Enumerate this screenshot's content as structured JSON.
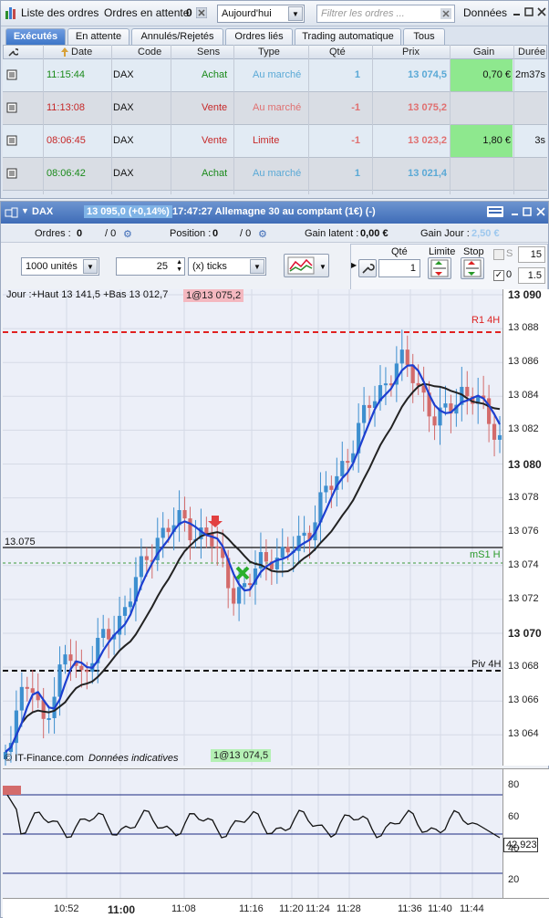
{
  "toolbar": {
    "list_label": "Liste des ordres",
    "pending_label": "Ordres en attente",
    "pending_count": "0",
    "period": "Aujourd'hui",
    "filter_placeholder": "Filtrer les ordres ...",
    "data_label": "Données"
  },
  "tabs": [
    "Exécutés",
    "En attente",
    "Annulés/Rejetés",
    "Ordres liés",
    "Trading automatique",
    "Tous"
  ],
  "grid": {
    "headers": [
      "Date",
      "Code",
      "Sens",
      "Type",
      "Qté",
      "Prix",
      "Gain",
      "Durée"
    ],
    "rows": [
      {
        "time": "11:15:44",
        "code": "DAX",
        "side": "Achat",
        "type": "Au marché",
        "qty": "1",
        "price": "13 074,5",
        "gain": "0,70 €",
        "duration": "2m37s"
      },
      {
        "time": "11:13:08",
        "code": "DAX",
        "side": "Vente",
        "type": "Au marché",
        "qty": "-1",
        "price": "13 075,2",
        "gain": "",
        "duration": ""
      },
      {
        "time": "08:06:45",
        "code": "DAX",
        "side": "Vente",
        "type": "Limite",
        "qty": "-1",
        "price": "13 023,2",
        "gain": "1,80 €",
        "duration": "3s"
      },
      {
        "time": "08:06:42",
        "code": "DAX",
        "side": "Achat",
        "type": "Au marché",
        "qty": "1",
        "price": "13 021,4",
        "gain": "",
        "duration": ""
      }
    ]
  },
  "chart": {
    "symbol": "DAX",
    "quote": "13 095,0 (+0,14%)",
    "title": "17:47:27 Allemagne 30 au comptant (1€) (-)",
    "orders_label": "Ordres :",
    "orders_val": "0",
    "orders_val2": "/ 0",
    "position_label": "Position :",
    "position_val": "0",
    "position_val2": "/ 0",
    "latent_label": "Gain latent :",
    "latent_val": "0,00 €",
    "day_label": "Gain Jour :",
    "day_val": "2,50 €",
    "units": "1000 unités",
    "ticks_val": "25",
    "ticks_unit": "(x) ticks",
    "qty_label": "Qté",
    "qty_val": "1",
    "limit_label": "Limite",
    "stop_label": "Stop",
    "s_label": "S",
    "s_val": "15",
    "zero_label": "0",
    "zero_val": "1.5",
    "jour_text": "Jour :+Haut 13 141,5 +Bas 13 012,7",
    "sell_tag": "1@13 075,2",
    "buy_tag": "1@13 074,5",
    "level_13075": "13.075",
    "r1": "R1 4H",
    "ms1": "mS1 H",
    "piv": "Piv 4H",
    "credit": "© IT-Finance.com",
    "credit2": "Données indicatives",
    "osc_value": "42,923",
    "price_ticks": [
      "13 090",
      "13 088",
      "13 086",
      "13 084",
      "13 082",
      "13 080",
      "13 078",
      "13 076",
      "13 074",
      "13 072",
      "13 070",
      "13 068",
      "13 066",
      "13 064"
    ],
    "osc_ticks": [
      "80",
      "60",
      "40",
      "20"
    ],
    "time_ticks": [
      "10:52",
      "11:00",
      "11:08",
      "11:16",
      "11:20",
      "11:24",
      "11:28",
      "11:36",
      "11:40",
      "11:44"
    ]
  },
  "colors": {
    "buy": "#1a8a1a",
    "sell": "#c62828",
    "market_buy": "#5aa9d6",
    "market_sell": "#e07070",
    "gain_bg": "#8ee88e",
    "candle_up": "#3d8fcf",
    "candle_down": "#d36b6b"
  }
}
